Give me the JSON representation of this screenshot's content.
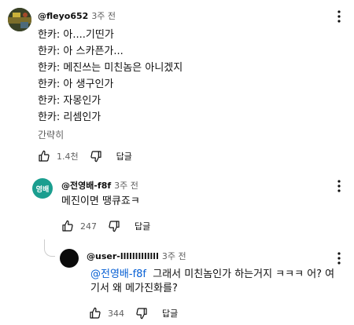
{
  "comments": [
    {
      "author": "@fleyo652",
      "time": "3주 전",
      "lines": [
        "한카: 아....기띤가",
        "한카: 아 스카픈가...",
        "한카: 메진쓰는 미친놈은 아니겠지",
        "한카: 아 생구인가",
        "한카: 자몽인가",
        "한카: 리셈인가"
      ],
      "collapse_label": "간략히",
      "likes": "1.4천",
      "reply_label": "답글"
    },
    {
      "author": "@전영배-f8f",
      "time": "3주 전",
      "avatar_text": "영배",
      "avatar_color": "#1a9e8f",
      "lines": [
        "메진이면 땡큐죠ㅋ"
      ],
      "likes": "247",
      "reply_label": "답글"
    },
    {
      "author": "@user-lllllllllllll",
      "time": "3주 전",
      "avatar_color": "#0b0b0b",
      "mention": "@전영배-f8f",
      "line1_rest": "그래서 미친놈인가 하는거지 ㅋㅋㅋ 어? 여",
      "line2": "기서 왜 메가진화를?",
      "likes": "344",
      "reply_label": "답글"
    }
  ]
}
